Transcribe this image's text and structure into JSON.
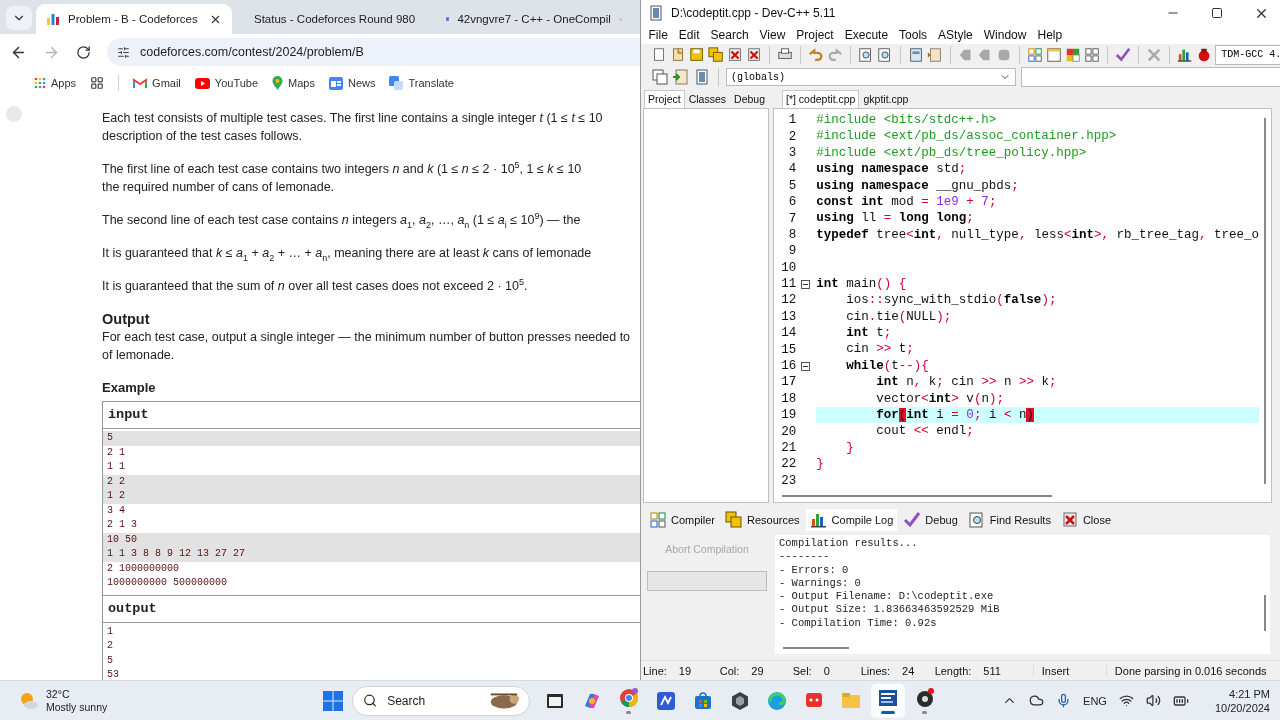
{
  "browser": {
    "tabs": [
      {
        "title": "Problem - B - Codeforces",
        "kind": "codeforces",
        "selected": true
      },
      {
        "title": "Status - Codeforces Round 980",
        "kind": "codeforces",
        "selected": false
      },
      {
        "title": "42vngvre7 - C++ - OneCompil",
        "kind": "code",
        "selected": false
      }
    ],
    "address": "codeforces.com/contest/2024/problem/B",
    "bookmarks": [
      {
        "label": "Apps",
        "kind": "apps"
      },
      {
        "label": "Gmail",
        "kind": "gmail"
      },
      {
        "label": "YouTube",
        "kind": "youtube"
      },
      {
        "label": "Maps",
        "kind": "maps"
      },
      {
        "label": "News",
        "kind": "news"
      },
      {
        "label": "Translate",
        "kind": "translate"
      }
    ]
  },
  "problem": {
    "paragraphs": [
      [
        "Each test consists of multiple test cases. The first line contains a single integer *t* (1 ≤ *t* ≤ 10",
        "description of the test cases follows."
      ],
      [
        "The first line of each test case contains two integers *n* and *k* (1 ≤ *n* ≤ 2 · 10$^{5}$, 1 ≤ *k* ≤ 10",
        "the required number of cans of lemonade."
      ],
      [
        "The second line of each test case contains *n* integers *a*$_{1}$, *a*$_{2}$, …, *a*$_{n}$ (1 ≤ *a*$_{i}$ ≤ 10$^{9}$) — the"
      ],
      [
        "It is guaranteed that *k* ≤ *a*$_{1}$ + *a*$_{2}$ + … + *a*$_{n}$, meaning there are at least *k* cans of lemonade"
      ],
      [
        "It is guaranteed that the sum of *n* over all test cases does not exceed 2 · 10$^{5}$."
      ]
    ],
    "output_heading": "Output",
    "output_text": [
      "For each test case, output a single integer — the minimum number of button presses needed to",
      "of lemonade."
    ],
    "example_heading": "Example",
    "input_label": "input",
    "input_lines": [
      {
        "text": "5",
        "shaded": true
      },
      {
        "text": "2 1",
        "shaded": false
      },
      {
        "text": "1 1",
        "shaded": false
      },
      {
        "text": "2 2",
        "shaded": true
      },
      {
        "text": "1 2",
        "shaded": true
      },
      {
        "text": "3 4",
        "shaded": false
      },
      {
        "text": "2 1 3",
        "shaded": false
      },
      {
        "text": "10 50",
        "shaded": true
      },
      {
        "text": "1 1 3 8 8 9 12 13 27 27",
        "shaded": true
      },
      {
        "text": "2 1000000000",
        "shaded": false
      },
      {
        "text": "1000000000 500000000",
        "shaded": false
      }
    ],
    "output_label": "output",
    "output_lines": [
      "1",
      "2",
      "5",
      "53"
    ]
  },
  "devcpp": {
    "title": "D:\\codeptit.cpp - Dev-C++ 5.11",
    "menu": [
      "File",
      "Edit",
      "Search",
      "View",
      "Project",
      "Execute",
      "Tools",
      "AStyle",
      "Window",
      "Help"
    ],
    "compiler_select": "TDM-GCC 4.",
    "scope_select": "(globals)",
    "left_tabs": [
      {
        "label": "Project",
        "selected": true
      },
      {
        "label": "Classes",
        "selected": false
      },
      {
        "label": "Debug",
        "selected": false
      }
    ],
    "editor_tabs": [
      {
        "label": "[*] codeptit.cpp",
        "selected": true
      },
      {
        "label": "gkptit.cpp",
        "selected": false
      }
    ],
    "code": [
      {
        "number": "1",
        "fold": false,
        "current": false,
        "tokens": [
          {
            "kind": "pp",
            "text": "#include <bits/stdc++.h>"
          }
        ]
      },
      {
        "number": "2",
        "fold": false,
        "current": false,
        "tokens": [
          {
            "kind": "pp",
            "text": "#include <ext/pb_ds/assoc_container.hpp>"
          }
        ]
      },
      {
        "number": "3",
        "fold": false,
        "current": false,
        "tokens": [
          {
            "kind": "pp",
            "text": "#include <ext/pb_ds/tree_policy.hpp>"
          }
        ]
      },
      {
        "number": "4",
        "fold": false,
        "current": false,
        "tokens": [
          {
            "kind": "kw",
            "text": "using namespace"
          },
          {
            "kind": "id",
            "text": " std"
          },
          {
            "kind": "sym",
            "text": ";"
          }
        ]
      },
      {
        "number": "5",
        "fold": false,
        "current": false,
        "tokens": [
          {
            "kind": "kw",
            "text": "using namespace"
          },
          {
            "kind": "id",
            "text": " __gnu_pbds"
          },
          {
            "kind": "sym",
            "text": ";"
          }
        ]
      },
      {
        "number": "6",
        "fold": false,
        "current": false,
        "tokens": [
          {
            "kind": "kw",
            "text": "const int"
          },
          {
            "kind": "id",
            "text": " mod "
          },
          {
            "kind": "sym",
            "text": "="
          },
          {
            "kind": "num",
            "text": " 1e9 "
          },
          {
            "kind": "sym",
            "text": "+"
          },
          {
            "kind": "num",
            "text": " 7"
          },
          {
            "kind": "sym",
            "text": ";"
          }
        ]
      },
      {
        "number": "7",
        "fold": false,
        "current": false,
        "tokens": [
          {
            "kind": "kw",
            "text": "using"
          },
          {
            "kind": "id",
            "text": " ll "
          },
          {
            "kind": "sym",
            "text": "="
          },
          {
            "kind": "kw",
            "text": " long long"
          },
          {
            "kind": "sym",
            "text": ";"
          }
        ]
      },
      {
        "number": "8",
        "fold": false,
        "current": false,
        "tokens": [
          {
            "kind": "kw",
            "text": "typedef"
          },
          {
            "kind": "id",
            "text": " tree"
          },
          {
            "kind": "sym",
            "text": "<"
          },
          {
            "kind": "kw",
            "text": "int"
          },
          {
            "kind": "sym",
            "text": ","
          },
          {
            "kind": "id",
            "text": " null_type"
          },
          {
            "kind": "sym",
            "text": ","
          },
          {
            "kind": "id",
            "text": " less"
          },
          {
            "kind": "sym",
            "text": "<"
          },
          {
            "kind": "kw",
            "text": "int"
          },
          {
            "kind": "sym",
            "text": ">,"
          },
          {
            "kind": "id",
            "text": " rb_tree_tag"
          },
          {
            "kind": "sym",
            "text": ","
          },
          {
            "kind": "id",
            "text": " tree_o"
          }
        ]
      },
      {
        "number": "9",
        "fold": false,
        "current": false
      },
      {
        "number": "10",
        "fold": false,
        "current": false
      },
      {
        "number": "11",
        "fold": true,
        "current": false,
        "tokens": [
          {
            "kind": "kw",
            "text": "int"
          },
          {
            "kind": "id",
            "text": " main"
          },
          {
            "kind": "sym",
            "text": "() {"
          }
        ]
      },
      {
        "number": "12",
        "fold": false,
        "current": false,
        "tokens": [
          {
            "kind": "id",
            "text": "    ios"
          },
          {
            "kind": "sym",
            "text": "::"
          },
          {
            "kind": "id",
            "text": "sync_with_stdio"
          },
          {
            "kind": "sym",
            "text": "("
          },
          {
            "kind": "kw",
            "text": "false"
          },
          {
            "kind": "sym",
            "text": ");"
          }
        ]
      },
      {
        "number": "13",
        "fold": false,
        "current": false,
        "tokens": [
          {
            "kind": "id",
            "text": "    cin"
          },
          {
            "kind": "sym",
            "text": "."
          },
          {
            "kind": "id",
            "text": "tie"
          },
          {
            "kind": "sym",
            "text": "("
          },
          {
            "kind": "id",
            "text": "NULL"
          },
          {
            "kind": "sym",
            "text": ");"
          }
        ]
      },
      {
        "number": "14",
        "fold": false,
        "current": false,
        "tokens": [
          {
            "kind": "kw",
            "text": "    int"
          },
          {
            "kind": "id",
            "text": " t"
          },
          {
            "kind": "sym",
            "text": ";"
          }
        ]
      },
      {
        "number": "15",
        "fold": false,
        "current": false,
        "tokens": [
          {
            "kind": "id",
            "text": "    cin "
          },
          {
            "kind": "sym",
            "text": ">>"
          },
          {
            "kind": "id",
            "text": " t"
          },
          {
            "kind": "sym",
            "text": ";"
          }
        ]
      },
      {
        "number": "16",
        "fold": true,
        "current": false,
        "tokens": [
          {
            "kind": "kw",
            "text": "    while"
          },
          {
            "kind": "sym",
            "text": "("
          },
          {
            "kind": "id",
            "text": "t"
          },
          {
            "kind": "sym",
            "text": "--){"
          }
        ]
      },
      {
        "number": "17",
        "fold": false,
        "current": false,
        "tokens": [
          {
            "kind": "kw",
            "text": "        int"
          },
          {
            "kind": "id",
            "text": " n"
          },
          {
            "kind": "sym",
            "text": ","
          },
          {
            "kind": "id",
            "text": " k"
          },
          {
            "kind": "sym",
            "text": ";"
          },
          {
            "kind": "id",
            "text": " cin "
          },
          {
            "kind": "sym",
            "text": ">>"
          },
          {
            "kind": "id",
            "text": " n "
          },
          {
            "kind": "sym",
            "text": ">>"
          },
          {
            "kind": "id",
            "text": " k"
          },
          {
            "kind": "sym",
            "text": ";"
          }
        ]
      },
      {
        "number": "18",
        "fold": false,
        "current": false,
        "tokens": [
          {
            "kind": "id",
            "text": "        vector"
          },
          {
            "kind": "sym",
            "text": "<"
          },
          {
            "kind": "kw",
            "text": "int"
          },
          {
            "kind": "sym",
            "text": ">"
          },
          {
            "kind": "id",
            "text": " v"
          },
          {
            "kind": "sym",
            "text": "("
          },
          {
            "kind": "id",
            "text": "n"
          },
          {
            "kind": "sym",
            "text": ");"
          }
        ]
      },
      {
        "number": "19",
        "fold": false,
        "current": true,
        "tokens": [
          {
            "kind": "kw",
            "text": "        for"
          },
          {
            "kind": "match",
            "text": "("
          },
          {
            "kind": "kw",
            "text": "int"
          },
          {
            "kind": "id",
            "text": " i "
          },
          {
            "kind": "sym",
            "text": "="
          },
          {
            "kind": "num",
            "text": " 0"
          },
          {
            "kind": "sym",
            "text": ";"
          },
          {
            "kind": "id",
            "text": " i "
          },
          {
            "kind": "sym",
            "text": "<"
          },
          {
            "kind": "id",
            "text": " n"
          },
          {
            "kind": "match",
            "text": ")"
          }
        ]
      },
      {
        "number": "20",
        "fold": false,
        "current": false,
        "tokens": [
          {
            "kind": "id",
            "text": "        cout "
          },
          {
            "kind": "sym",
            "text": "<<"
          },
          {
            "kind": "id",
            "text": " endl"
          },
          {
            "kind": "sym",
            "text": ";"
          }
        ]
      },
      {
        "number": "21",
        "fold": false,
        "current": false,
        "tokens": [
          {
            "kind": "sym",
            "text": "    }"
          }
        ]
      },
      {
        "number": "22",
        "fold": false,
        "current": false,
        "tokens": [
          {
            "kind": "sym",
            "text": "}"
          }
        ]
      },
      {
        "number": "23",
        "fold": false,
        "current": false
      }
    ],
    "bottom_tabs": [
      {
        "label": "Compiler",
        "kind": "compiler",
        "selected": false
      },
      {
        "label": "Resources",
        "kind": "resources",
        "selected": false
      },
      {
        "label": "Compile Log",
        "kind": "log",
        "selected": true
      },
      {
        "label": "Debug",
        "kind": "debug",
        "selected": false
      },
      {
        "label": "Find Results",
        "kind": "find",
        "selected": false
      },
      {
        "label": "Close",
        "kind": "close",
        "selected": false
      }
    ],
    "abort_button": {
      "label": "Abort Compilation",
      "disabled": true
    },
    "progress": {
      "level": 0
    },
    "log": [
      "Compilation results...",
      "--------",
      "- Errors: 0",
      "- Warnings: 0",
      "- Output Filename: D:\\codeptit.exe",
      "- Output Size: 1.83663463592529 MiB",
      "- Compilation Time: 0.92s"
    ],
    "status": [
      {
        "label": "Line:",
        "value": "19"
      },
      {
        "label": "Col:",
        "value": "29"
      },
      {
        "label": "Sel:",
        "value": "0"
      },
      {
        "label": "Lines:",
        "value": "24"
      },
      {
        "label": "Length:",
        "value": "511"
      }
    ],
    "mode": "Insert",
    "message": "Done parsing in 0.016 seconds"
  },
  "taskbar": {
    "weather": {
      "temperature": "32°C",
      "condition": "Mostly sunny"
    },
    "search_placeholder": "Search",
    "apps": [
      {
        "kind": "terminal",
        "running": false,
        "active": false
      },
      {
        "kind": "copilot",
        "running": false,
        "active": false
      },
      {
        "kind": "chrome",
        "running": true,
        "active": false
      },
      {
        "kind": "editor",
        "running": false,
        "active": false
      },
      {
        "kind": "store",
        "running": false,
        "active": false
      },
      {
        "kind": "cube",
        "running": false,
        "active": false
      },
      {
        "kind": "edge",
        "running": false,
        "active": false
      },
      {
        "kind": "chat",
        "running": false,
        "active": false
      },
      {
        "kind": "folder",
        "running": false,
        "active": false
      },
      {
        "kind": "devcpp",
        "running": true,
        "active": true
      },
      {
        "kind": "music",
        "running": true,
        "active": false
      }
    ],
    "language": "ENG",
    "time": "4:21 PM",
    "date": "10/20/2024"
  }
}
